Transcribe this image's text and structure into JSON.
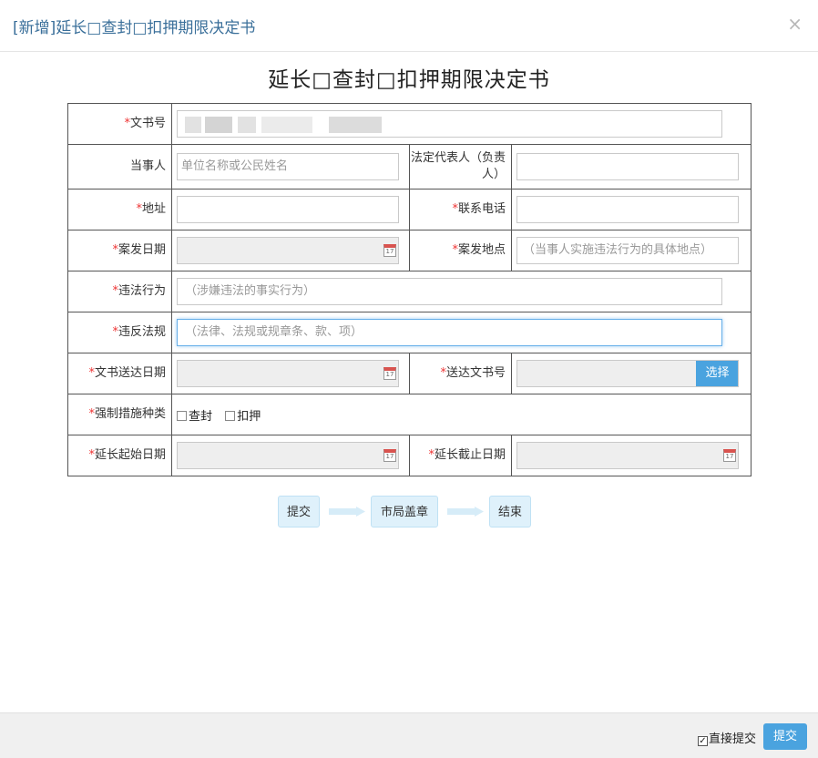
{
  "modal": {
    "title": "[新增]延长□查封□扣押期限决定书",
    "close": "×"
  },
  "document": {
    "title": "延长□查封□扣押期限决定书"
  },
  "form": {
    "required_mark": "*",
    "doc_number": {
      "label": "文书号",
      "value": ""
    },
    "party": {
      "label": "当事人",
      "placeholder": "单位名称或公民姓名"
    },
    "legal_rep": {
      "label": "法定代表人（负责人）",
      "value": ""
    },
    "address": {
      "label": "地址",
      "value": ""
    },
    "phone": {
      "label": "联系电话",
      "value": ""
    },
    "case_date": {
      "label": "案发日期",
      "value": ""
    },
    "case_place": {
      "label": "案发地点",
      "placeholder": "（当事人实施违法行为的具体地点）"
    },
    "violation": {
      "label": "违法行为",
      "placeholder": "（涉嫌违法的事实行为）"
    },
    "law_violated": {
      "label": "违反法规",
      "placeholder": "（法律、法规或规章条、款、项）"
    },
    "delivery_date": {
      "label": "文书送达日期",
      "value": ""
    },
    "delivery_doc_no": {
      "label": "送达文书号",
      "button": "选择"
    },
    "measure_type": {
      "label": "强制措施种类",
      "options": [
        "查封",
        "扣押"
      ]
    },
    "extend_start": {
      "label": "延长起始日期",
      "value": ""
    },
    "extend_end": {
      "label": "延长截止日期",
      "value": ""
    },
    "calendar_day": "17"
  },
  "workflow": {
    "steps": [
      "提交",
      "市局盖章",
      "结束"
    ]
  },
  "footer": {
    "direct_submit_label": "直接提交",
    "direct_submit_checked": true,
    "submit_label": "提交"
  },
  "colors": {
    "accent": "#4aa3df",
    "title": "#3a6f9a",
    "required": "#e33333",
    "flow_node": "#dff1fb"
  }
}
